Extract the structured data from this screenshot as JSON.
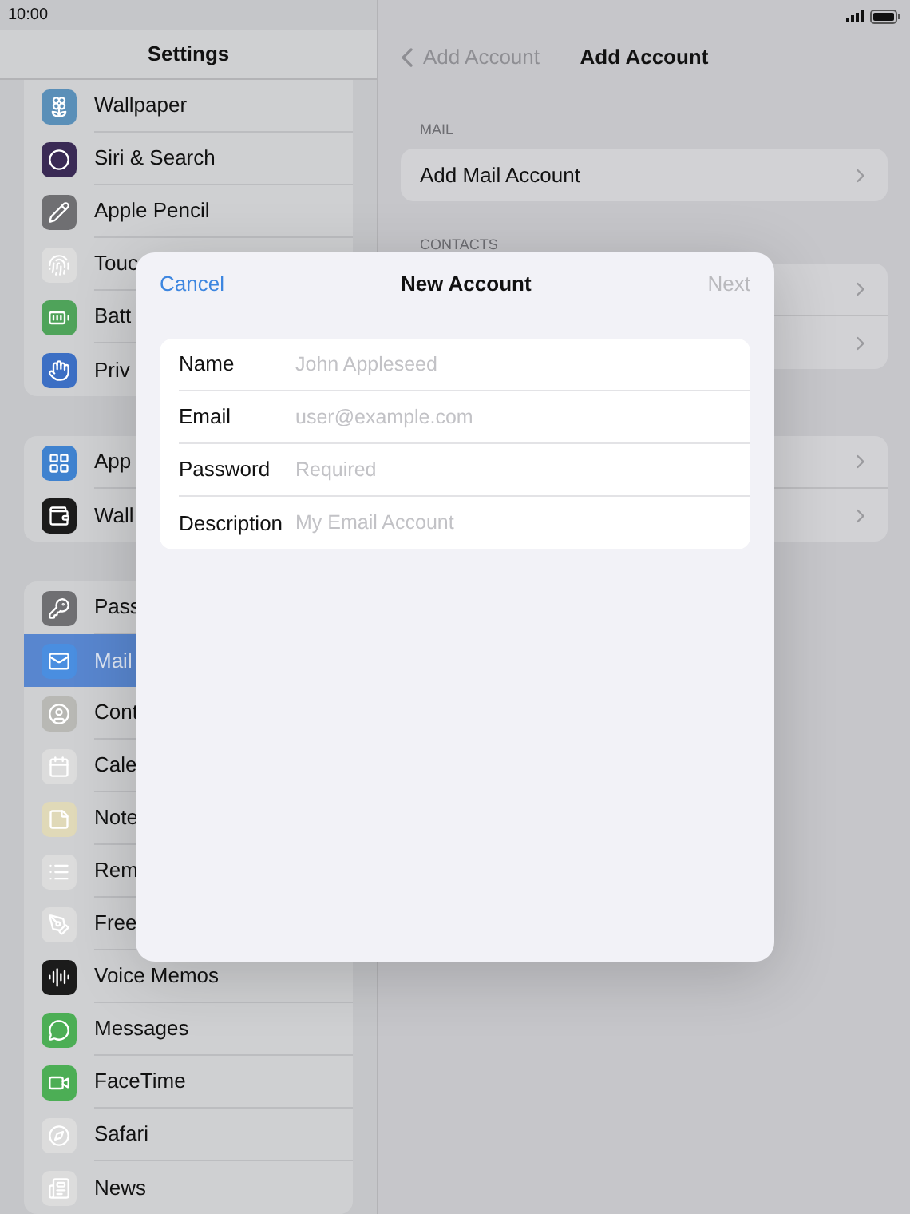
{
  "status_bar": {
    "time": "10:00"
  },
  "sidebar": {
    "title": "Settings",
    "groups": [
      {
        "items": [
          {
            "label": "Wallpaper",
            "selected": false
          },
          {
            "label": "Siri & Search",
            "selected": false
          },
          {
            "label": "Apple Pencil",
            "selected": false
          },
          {
            "label": "Touc",
            "selected": false
          },
          {
            "label": "Batt",
            "selected": false
          },
          {
            "label": "Priv",
            "selected": false
          }
        ]
      },
      {
        "items": [
          {
            "label": "App",
            "selected": false
          },
          {
            "label": "Wall",
            "selected": false
          }
        ]
      },
      {
        "items": [
          {
            "label": "Pass",
            "selected": false
          },
          {
            "label": "Mail",
            "selected": true
          },
          {
            "label": "Cont",
            "selected": false
          },
          {
            "label": "Cale",
            "selected": false
          },
          {
            "label": "Note",
            "selected": false
          },
          {
            "label": "Rem",
            "selected": false
          },
          {
            "label": "Free",
            "selected": false
          },
          {
            "label": "Voice Memos",
            "selected": false
          },
          {
            "label": "Messages",
            "selected": false
          },
          {
            "label": "FaceTime",
            "selected": false
          },
          {
            "label": "Safari",
            "selected": false
          },
          {
            "label": "News",
            "selected": false
          }
        ]
      }
    ]
  },
  "detail": {
    "back_button": "Add Account",
    "title": "Add Account",
    "sections": [
      {
        "header": "MAIL",
        "rows": [
          {
            "label": "Add Mail Account",
            "chevron": true
          }
        ]
      },
      {
        "header": "CONTACTS",
        "rows": [
          {
            "chevron": true
          },
          {
            "chevron": true
          }
        ]
      },
      {
        "rows": [
          {
            "chevron": true
          },
          {
            "chevron": true
          }
        ]
      }
    ]
  },
  "dialog": {
    "cancel": "Cancel",
    "title": "New Account",
    "next": {
      "label": "Next",
      "disabled": true
    },
    "fields": [
      {
        "label": "Name",
        "placeholder": "John Appleseed"
      },
      {
        "label": "Email",
        "placeholder": "user@example.com"
      },
      {
        "label": "Password",
        "placeholder": "Required"
      },
      {
        "label": "Description",
        "placeholder": "My Email Account"
      }
    ]
  }
}
